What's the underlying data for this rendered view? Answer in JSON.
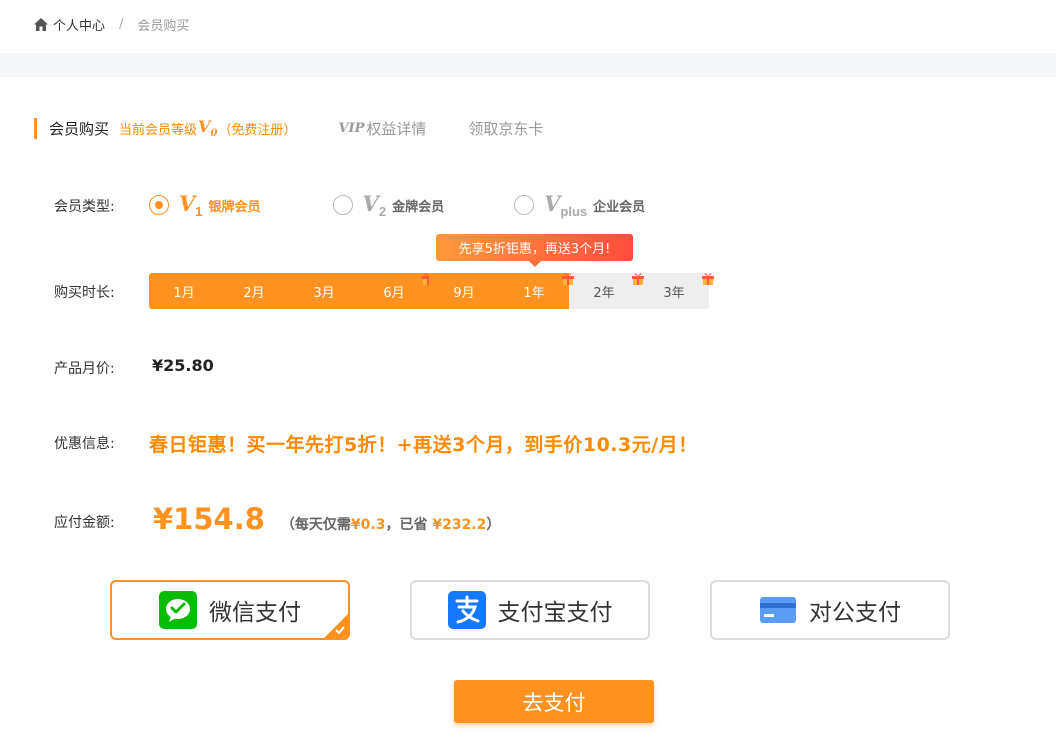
{
  "breadcrumb": {
    "home": "个人中心",
    "separator": "/",
    "current": "会员购买"
  },
  "tabs": {
    "active": "会员购买",
    "level_prefix": "当前会员等级",
    "level_v": "V",
    "level_num": "0",
    "level_suffix": "（免费注册）",
    "vip_logo": "VIP",
    "vip_text": "权益详情",
    "jd_card": "领取京东卡"
  },
  "member_type": {
    "label": "会员类型:",
    "options": [
      {
        "v": "V",
        "sub": "1",
        "name": "银牌会员",
        "selected": true
      },
      {
        "v": "V",
        "sub": "2",
        "name": "金牌会员",
        "selected": false
      },
      {
        "v": "V",
        "sub": "plus",
        "name": "企业会员",
        "selected": false
      }
    ]
  },
  "duration": {
    "label": "购买时长:",
    "tooltip": "先享5折钜惠，再送3个月!",
    "options": [
      "1月",
      "2月",
      "3月",
      "6月",
      "9月",
      "1年",
      "2年",
      "3年"
    ],
    "selected": "1年"
  },
  "monthly_price": {
    "label": "产品月价:",
    "value": "¥25.80"
  },
  "promo": {
    "label": "优惠信息:",
    "text": "春日钜惠！买一年先打5折！+再送3个月，到手价10.3元/月！"
  },
  "total": {
    "label": "应付金额:",
    "amount": "¥154.8",
    "note_open": "（每天仅需",
    "per_day": "¥0.3",
    "note_mid": "，已省 ",
    "saved": "¥232.2",
    "note_close": "）"
  },
  "payment": {
    "methods": [
      {
        "label": "微信支付",
        "icon": "wechat-pay-icon",
        "selected": true
      },
      {
        "label": "支付宝支付",
        "icon": "alipay-icon",
        "selected": false
      },
      {
        "label": "对公支付",
        "icon": "bank-card-icon",
        "selected": false
      }
    ],
    "submit": "去支付"
  },
  "colors": {
    "accent": "#ff9220",
    "wechat": "#09bb07",
    "alipay": "#1677ff",
    "bank": "#5b9cf5"
  }
}
